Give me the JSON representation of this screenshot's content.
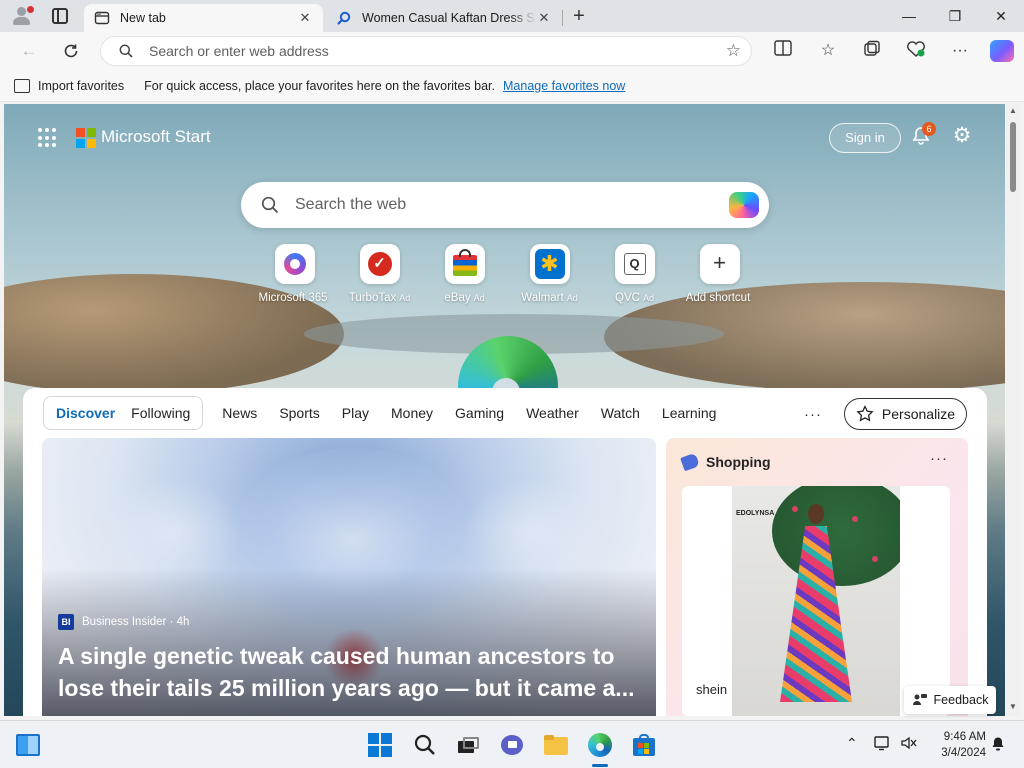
{
  "browser": {
    "tabs": [
      {
        "label": "New tab",
        "active": true
      },
      {
        "label": "Women Casual Kaftan Dress Sho",
        "active": false
      }
    ],
    "new_tab_glyph": "+",
    "window_controls": {
      "minimize": "—",
      "restore": "❐",
      "close": "✕"
    },
    "address_placeholder": "Search or enter web address",
    "favorites_bar": {
      "import_label": "Import favorites",
      "message": "For quick access, place your favorites here on the favorites bar.",
      "manage_link": "Manage favorites now"
    }
  },
  "start_page": {
    "brand": "Microsoft Start",
    "sign_in": "Sign in",
    "notification_count": "6",
    "search_placeholder": "Search the web",
    "shortcuts": [
      {
        "label": "Microsoft 365",
        "ad": ""
      },
      {
        "label": "TurboTax",
        "ad": "Ad"
      },
      {
        "label": "eBay",
        "ad": "Ad"
      },
      {
        "label": "Walmart",
        "ad": "Ad"
      },
      {
        "label": "QVC",
        "ad": "Ad"
      },
      {
        "label": "Add shortcut",
        "ad": ""
      }
    ],
    "feed_tabs": {
      "pill": [
        "Discover",
        "Following"
      ],
      "others": [
        "News",
        "Sports",
        "Play",
        "Money",
        "Gaming",
        "Weather",
        "Watch",
        "Learning"
      ]
    },
    "more_glyph": "···",
    "personalize": "Personalize",
    "hero": {
      "source_badge": "BI",
      "source": "Business Insider · 4h",
      "headline": "A single genetic tweak caused human ancestors to lose their tails 25 million years ago — but it came a..."
    },
    "shopping": {
      "title": "Shopping",
      "image_brand_mark": "EDOLYNSA",
      "brand": "shein"
    },
    "feedback": "Feedback"
  },
  "taskbar": {
    "time": "9:46 AM",
    "date": "3/4/2024"
  },
  "colors": {
    "accent": "#0f6cbd",
    "notification_badge": "#e3591e",
    "ms_logo": [
      "#f25022",
      "#7fba00",
      "#00a4ef",
      "#ffb900"
    ]
  }
}
